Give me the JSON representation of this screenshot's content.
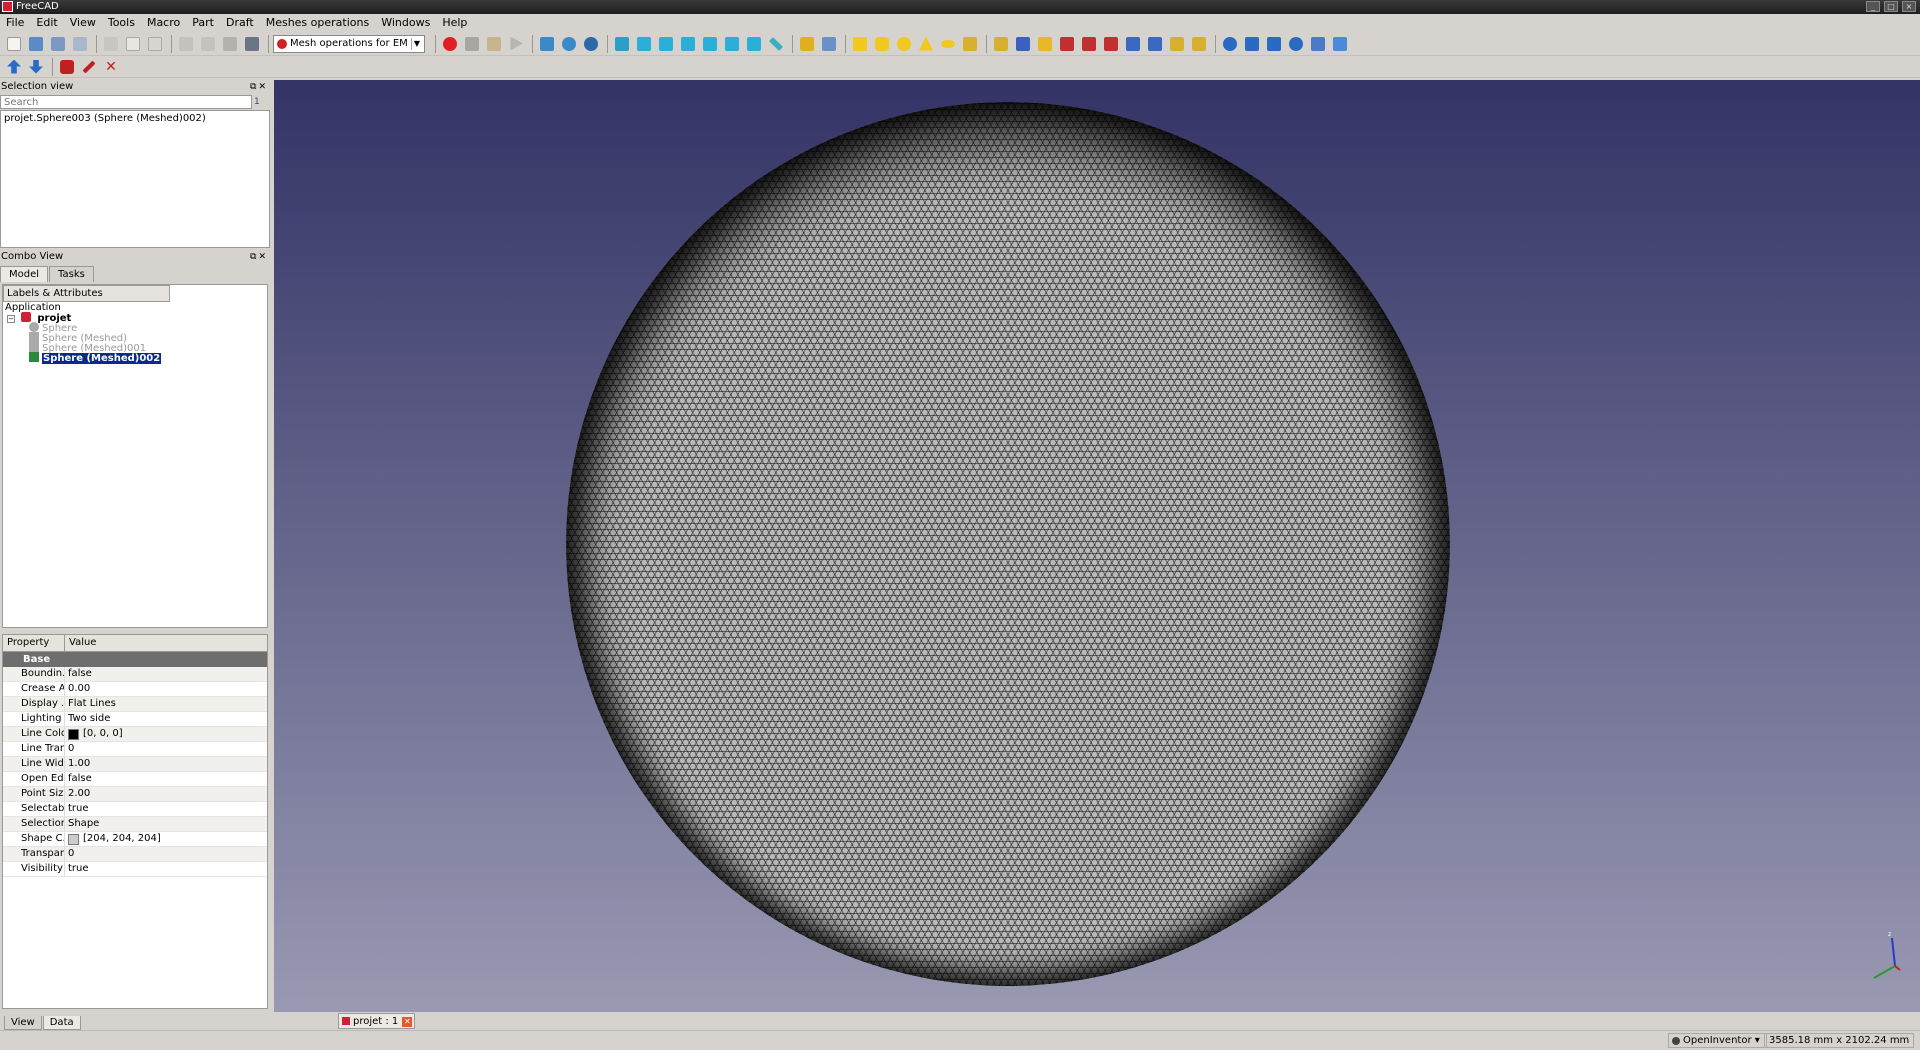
{
  "window": {
    "title": "FreeCAD"
  },
  "menu": [
    "File",
    "Edit",
    "View",
    "Tools",
    "Macro",
    "Part",
    "Draft",
    "Meshes operations",
    "Windows",
    "Help"
  ],
  "workbench_selector": {
    "value": "Mesh operations for EM"
  },
  "selection_view": {
    "title": "Selection view",
    "search_placeholder": "Search",
    "count": "1",
    "items": [
      "projet.Sphere003 (Sphere (Meshed)002)"
    ]
  },
  "combo_view": {
    "title": "Combo View",
    "tabs": [
      "Model",
      "Tasks"
    ],
    "tree_header": "Labels & Attributes",
    "tree": {
      "root": "Application",
      "document": "projet",
      "items": [
        "Sphere",
        "Sphere (Meshed)",
        "Sphere (Meshed)001",
        "Sphere (Meshed)002"
      ],
      "selected": "Sphere (Meshed)002"
    },
    "properties": {
      "col_property": "Property",
      "col_value": "Value",
      "group": "Base",
      "rows": [
        {
          "name": "Boundin...",
          "value": "false"
        },
        {
          "name": "Crease A...",
          "value": "0.00"
        },
        {
          "name": "Display ...",
          "value": "Flat Lines"
        },
        {
          "name": "Lighting",
          "value": "Two side"
        },
        {
          "name": "Line Color",
          "value": "[0, 0, 0]",
          "swatch": "#000000"
        },
        {
          "name": "Line Tran...",
          "value": "0"
        },
        {
          "name": "Line Width",
          "value": "1.00"
        },
        {
          "name": "Open Ed...",
          "value": "false"
        },
        {
          "name": "Point Size",
          "value": "2.00"
        },
        {
          "name": "Selectable",
          "value": "true"
        },
        {
          "name": "Selection...",
          "value": "Shape"
        },
        {
          "name": "Shape C...",
          "value": "[204, 204, 204]",
          "swatch": "#cccccc"
        },
        {
          "name": "Transpar...",
          "value": "0"
        },
        {
          "name": "Visibility",
          "value": "true"
        }
      ]
    },
    "bottom_tabs": [
      "View",
      "Data"
    ]
  },
  "document_tab": {
    "label": "projet : 1"
  },
  "status": {
    "navigation_style": "OpenInventor",
    "dimensions": "3585.18 mm x 2102.24 mm"
  },
  "colors": {
    "viewport_top": "#333366",
    "viewport_bottom": "#9999b3",
    "selection": "#0a2b8c",
    "mesh_shape": "#cccccc"
  },
  "toolbar_icons": [
    "new-icon",
    "open-icon",
    "save-icon",
    "save-as-icon",
    "cut-icon",
    "copy-icon",
    "paste-icon",
    "undo-icon",
    "redo-icon",
    "refresh-icon",
    "whats-this-icon",
    "record-macro-icon",
    "stop-macro-icon",
    "edit-macro-icon",
    "run-macro-icon",
    "fit-all-icon",
    "fit-selection-icon",
    "draw-style-icon",
    "view-isometric-icon",
    "view-front-icon",
    "view-top-icon",
    "view-right-icon",
    "view-rear-icon",
    "view-bottom-icon",
    "view-left-icon",
    "measure-icon",
    "part-icon",
    "group-icon",
    "box-icon",
    "cylinder-icon",
    "sphere-icon",
    "cone-icon",
    "torus-icon",
    "primitives-icon",
    "shape-builder-icon",
    "extrude-icon",
    "revolve-icon",
    "mirror-icon",
    "fillet-icon",
    "chamfer-icon",
    "make-face-icon",
    "ruled-surface-icon",
    "loft-icon",
    "sweep-icon",
    "boolean-icon",
    "cut-boolean-icon",
    "fuse-icon",
    "common-icon",
    "section-icon",
    "cross-section-icon"
  ]
}
